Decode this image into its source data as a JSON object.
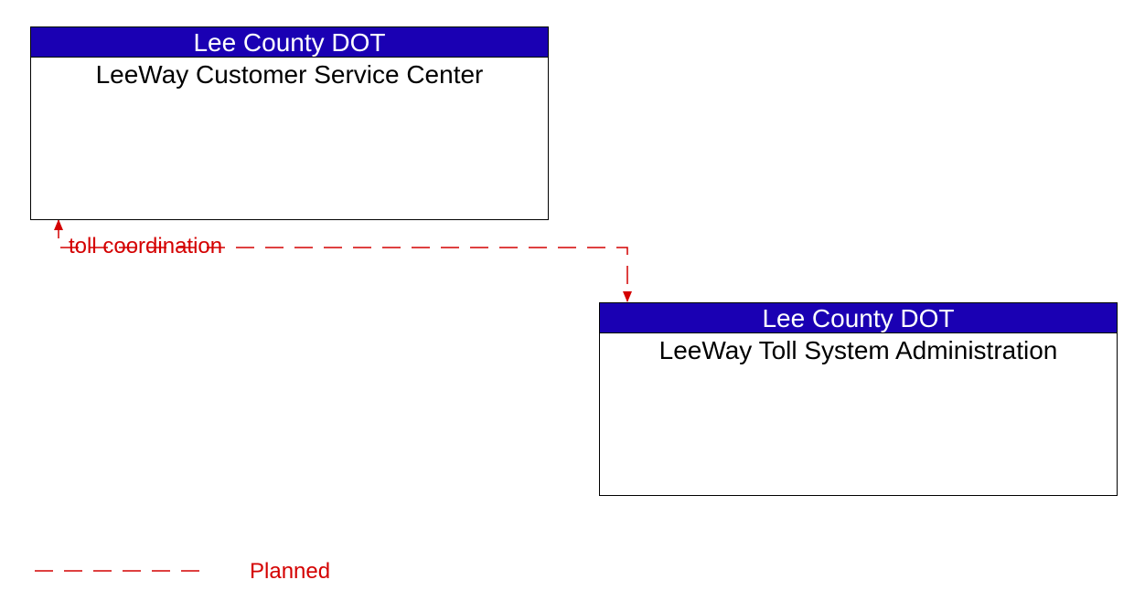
{
  "nodes": {
    "top": {
      "header": "Lee County DOT",
      "title": "LeeWay Customer Service Center"
    },
    "bottom": {
      "header": "Lee County DOT",
      "title": "LeeWay Toll System Administration"
    }
  },
  "flow": {
    "label": "toll coordination"
  },
  "legend": {
    "label": "Planned"
  },
  "colors": {
    "header_bg": "#1a00b3",
    "flow_line": "#d40000"
  }
}
